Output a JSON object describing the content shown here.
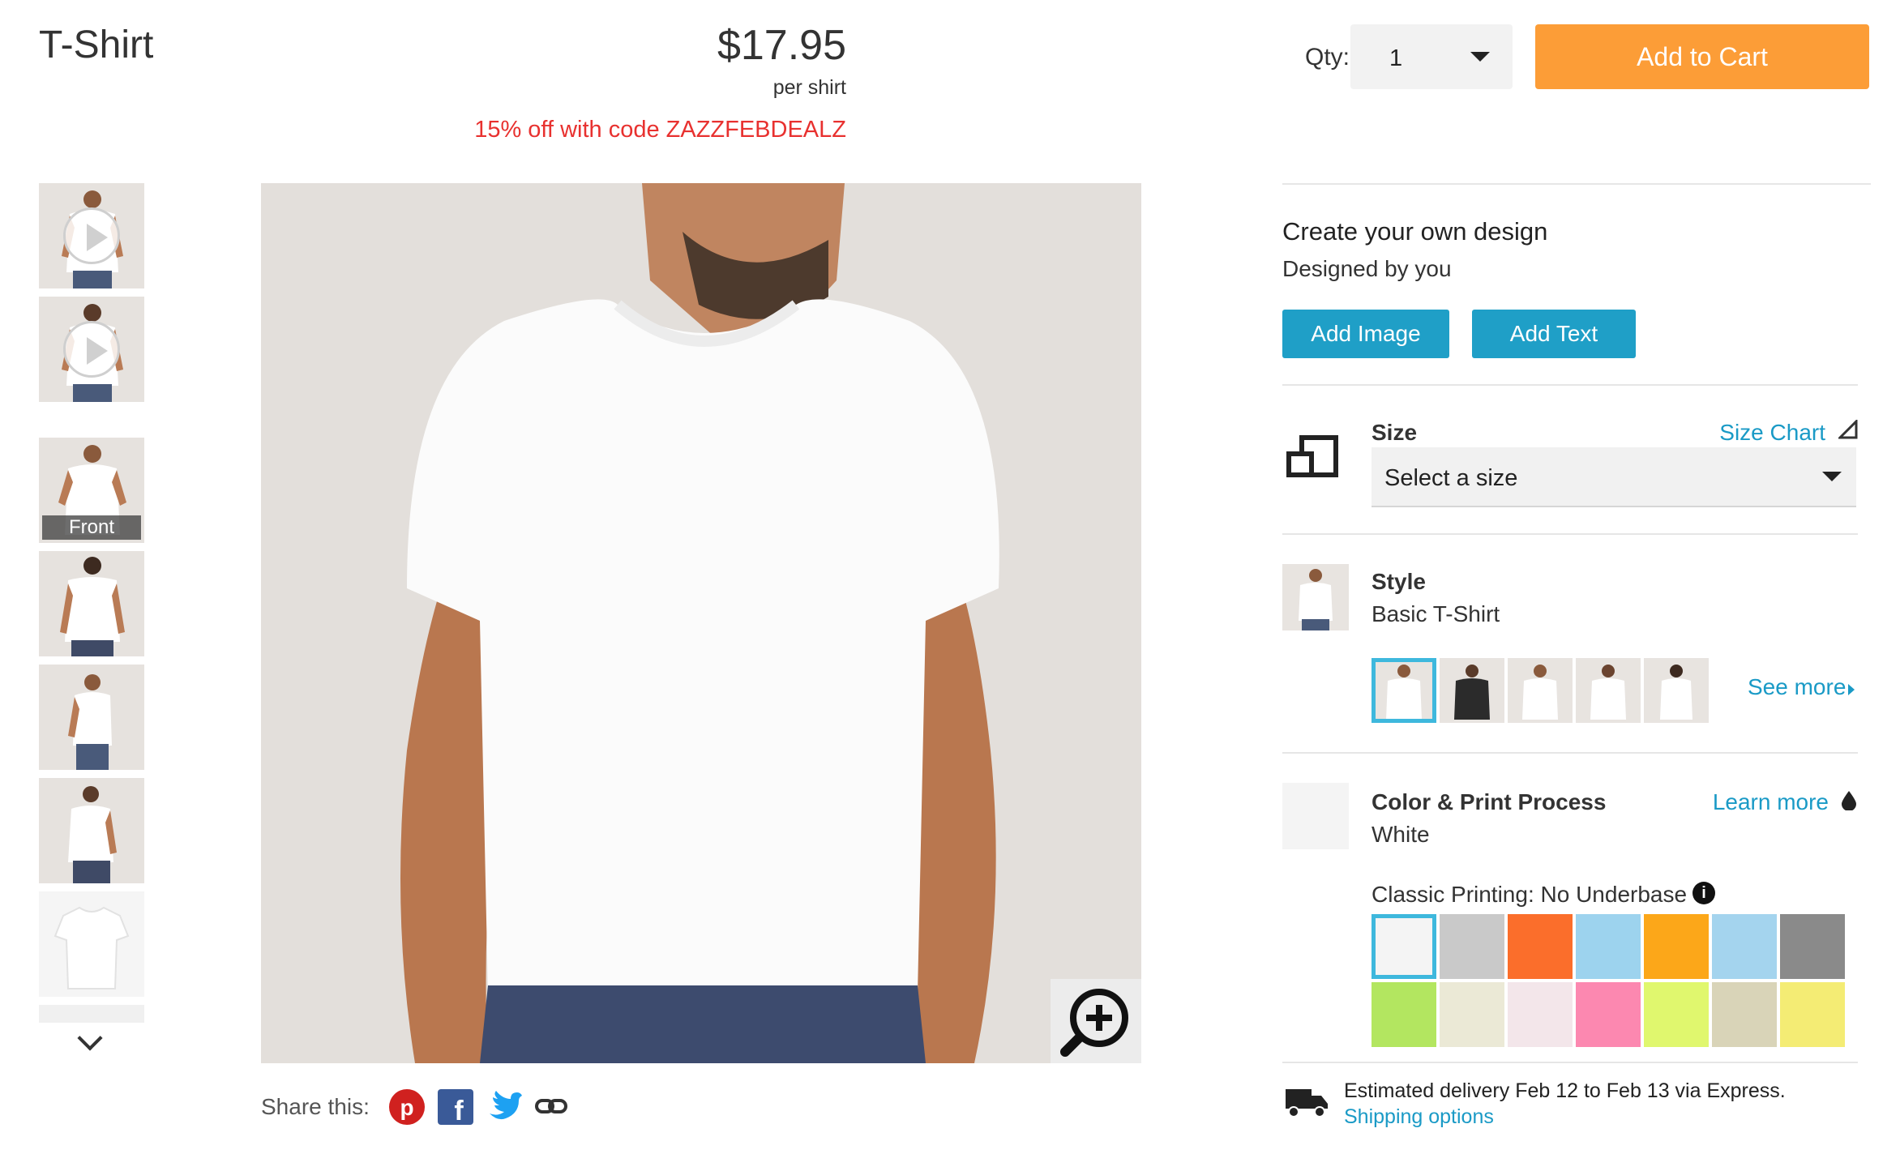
{
  "header": {
    "title": "T-Shirt",
    "price": "$17.95",
    "price_unit": "per shirt",
    "promo": "15% off with code ZAZZFEBDEALZ",
    "qty_label": "Qty:",
    "qty_value": "1",
    "add_to_cart": "Add to Cart"
  },
  "gallery": {
    "selected_label": "Front"
  },
  "share": {
    "label": "Share this:"
  },
  "design": {
    "heading": "Create your own design",
    "subheading": "Designed by you",
    "add_image": "Add Image",
    "add_text": "Add Text"
  },
  "size": {
    "label": "Size",
    "chart_link": "Size Chart",
    "placeholder": "Select a size"
  },
  "style": {
    "label": "Style",
    "value": "Basic T-Shirt",
    "see_more": "See more"
  },
  "color": {
    "label": "Color & Print Process",
    "value": "White",
    "learn_more": "Learn more",
    "printing_label": "Classic Printing: No Underbase",
    "swatches": [
      "#f4f4f4",
      "#c9c9c9",
      "#fb6e2b",
      "#9dd3ee",
      "#fca719",
      "#a4d4ee",
      "#8a8a8a",
      "#b3e660",
      "#ebe9d6",
      "#f3e6ea",
      "#fc88b0",
      "#e0f76e",
      "#d9d4b8",
      "#f4ec74"
    ]
  },
  "delivery": {
    "text": "Estimated delivery Feb 12 to Feb 13 via Express.",
    "shipping_link": "Shipping options"
  },
  "colors": {
    "accent": "#1f9fc7",
    "cta": "#fc9d37",
    "promo": "#e8312f",
    "selected_outline": "#3eb8dd"
  }
}
